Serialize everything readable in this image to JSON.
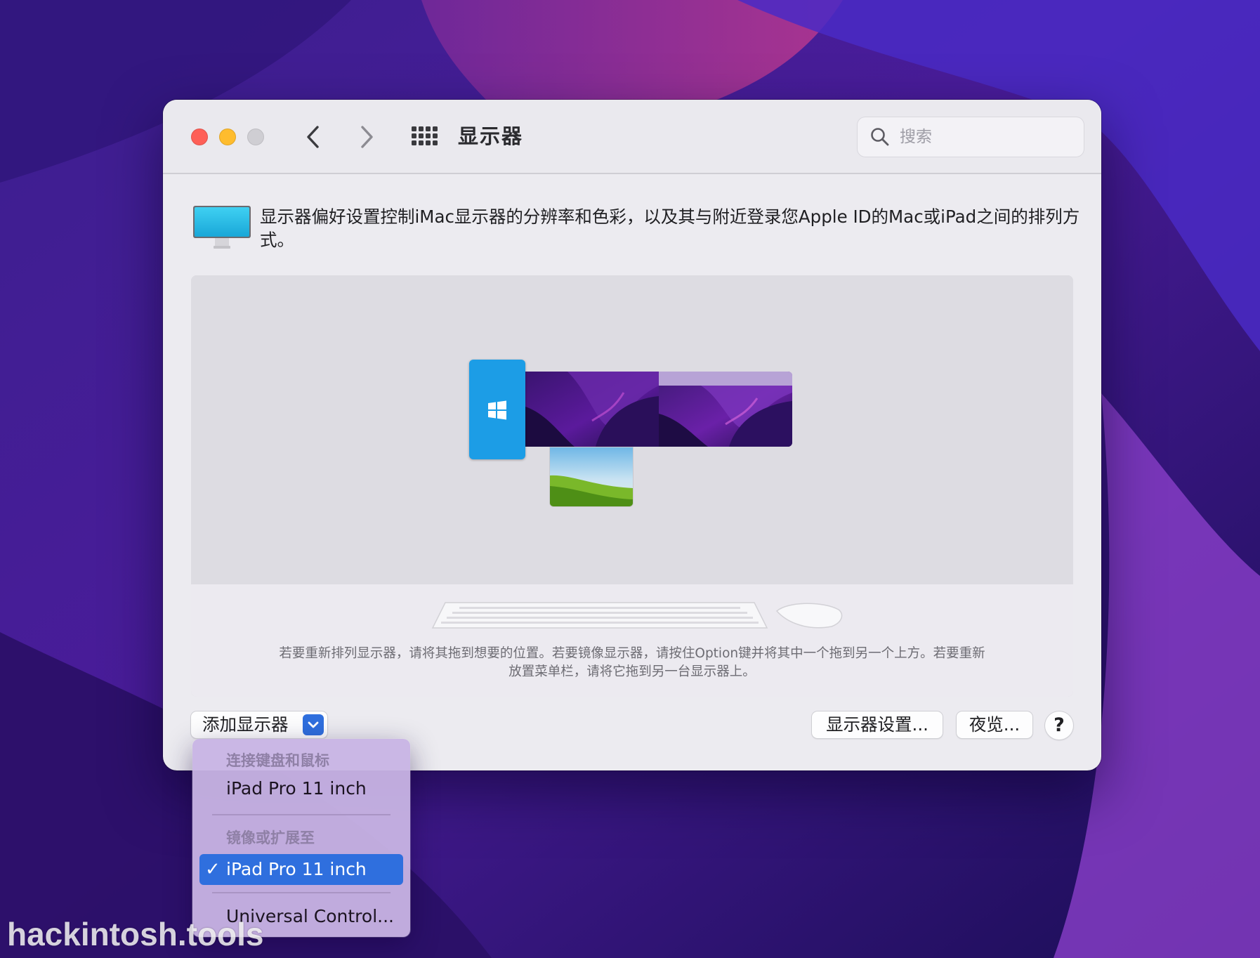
{
  "window": {
    "title": "显示器",
    "search_placeholder": "搜索"
  },
  "description": "显示器偏好设置控制iMac显示器的分辨率和色彩，以及其与附近登录您Apple ID的Mac或iPad之间的排列方式。",
  "arrangement": {
    "displays": [
      "windows-display",
      "imac-display",
      "main-display",
      "ipad-display"
    ],
    "hint": "若要重新排列显示器，请将其拖到想要的位置。若要镜像显示器，请按住Option键并将其中一个拖到另一个上方。若要重新放置菜单栏，请将它拖到另一台显示器上。"
  },
  "buttons": {
    "add_display": "添加显示器",
    "display_settings": "显示器设置...",
    "night_shift": "夜览...",
    "help": "?"
  },
  "add_menu": {
    "section1": "连接键盘和鼠标",
    "item1": "iPad Pro 11 inch",
    "section2": "镜像或扩展至",
    "item2": "iPad Pro 11 inch",
    "item2_checkmark": "✓",
    "item3": "Universal Control..."
  },
  "watermark": "hackintosh.tools",
  "colors": {
    "accent": "#2f6fde",
    "close": "#fe5f57",
    "minimize": "#febc2e",
    "windows_blue": "#1c9de6"
  }
}
